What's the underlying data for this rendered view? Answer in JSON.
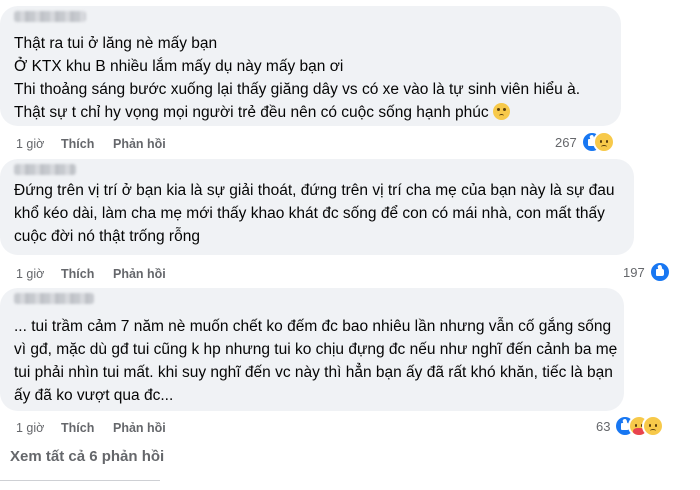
{
  "comments": [
    {
      "lines": [
        "Thật ra tui ở lăng nè mấy bạn",
        "Ở KTX khu B nhiều lắm mấy dụ này mấy bạn ơi",
        "Thi thoảng sáng bước xuống lại thấy giăng dây vs có xe vào là tự sinh viên hiểu à.",
        "Thật sự t chỉ hy vọng mọi người trẻ đều nên có cuộc sống hạnh phúc"
      ],
      "emoji": "crying-face",
      "time": "1 giờ",
      "like": "Thích",
      "reply": "Phản hồi",
      "reaction_count": "267",
      "reactions": [
        "like",
        "sad"
      ]
    },
    {
      "lines": [
        "Đứng trên vị trí ở bạn kia là sự giải thoát, đứng trên vị trí cha mẹ của bạn này là sự đau",
        "khổ kéo dài, làm cha mẹ mới thấy khao khát đc sống để con có mái nhà, con mất thấy",
        "cuộc đời nó thật trống rỗng"
      ],
      "time": "1 giờ",
      "like": "Thích",
      "reply": "Phản hồi",
      "reaction_count": "197",
      "reactions": [
        "like"
      ]
    },
    {
      "lines": [
        "... tui trầm cảm 7 năm nè muốn chết ko đếm đc bao nhiêu lần nhưng vẫn cố gắng sống",
        "vì gđ, mặc dù gđ tui cũng k hp nhưng tui ko chịu đựng đc nếu như nghĩ đến cảnh ba mẹ",
        "tui phải nhìn tui mất. khi suy nghĩ đến vc này thì hẳn bạn ấy đã rất khó khăn, tiếc là bạn",
        "ấy đã ko vượt qua đc..."
      ],
      "time": "1 giờ",
      "like": "Thích",
      "reply": "Phản hồi",
      "reaction_count": "63",
      "reactions": [
        "like",
        "care",
        "sad"
      ]
    }
  ],
  "view_more": "Xem tất cả 6 phản hồi",
  "colors": {
    "bubble": "#f0f2f5",
    "text": "#050505",
    "meta": "#65676b",
    "like_blue": "#1877f2",
    "emoji_yellow": "#f7c94a"
  }
}
